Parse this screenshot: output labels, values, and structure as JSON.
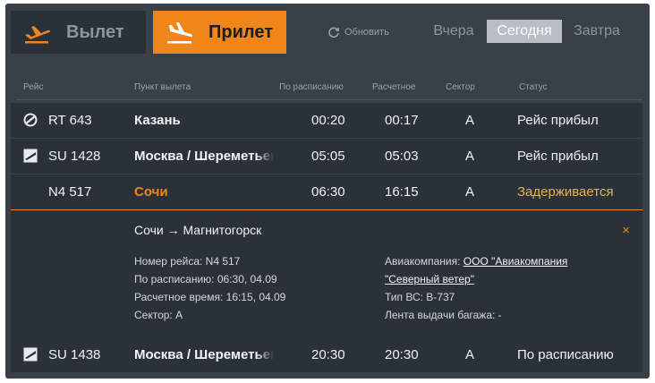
{
  "tabs": {
    "departure": {
      "label": "Вылет"
    },
    "arrival": {
      "label": "Прилет"
    }
  },
  "refresh": {
    "label": "Обновить"
  },
  "days": {
    "yesterday": "Вчера",
    "today": "Сегодня",
    "tomorrow": "Завтра"
  },
  "columns": {
    "flight": "Рейс",
    "origin": "Пункт вылета",
    "scheduled": "По расписанию",
    "estimated": "Расчетное",
    "sector": "Сектор",
    "status": "Статус"
  },
  "flights": [
    {
      "icon": "airline-circle-logo-icon",
      "flight": "RT 643",
      "city": "Казань",
      "scheduled": "00:20",
      "estimated": "00:17",
      "sector": "A",
      "status": "Рейс прибыл"
    },
    {
      "icon": "airline-wing-logo-icon",
      "flight": "SU 1428",
      "city": "Москва / Шереметьево",
      "scheduled": "05:05",
      "estimated": "05:03",
      "sector": "A",
      "status": "Рейс прибыл"
    },
    {
      "icon": "",
      "flight": "N4 517",
      "city": "Сочи",
      "scheduled": "06:30",
      "estimated": "16:15",
      "sector": "A",
      "status": "Задерживается"
    },
    {
      "icon": "airline-wing-logo-icon",
      "flight": "SU 1438",
      "city": "Москва / Шереметьево",
      "scheduled": "20:30",
      "estimated": "20:30",
      "sector": "A",
      "status": "По расписанию"
    }
  ],
  "detail": {
    "route": "Сочи → Магнитогорск",
    "flight_number": "Номер рейса: N4 517",
    "scheduled": "По расписанию: 06:30, 04.09",
    "estimated": "Расчетное время: 16:15, 04.09",
    "sector": "Сектор: A",
    "airline_label": "Авиакомпания:",
    "airline_line1": "ООО \"Авиакомпания",
    "airline_line2": "\"Северный ветер\"",
    "aircraft": "Тип ВС: B-737",
    "baggage": "Лента выдачи багажа: -",
    "close": "×"
  },
  "colors": {
    "accent": "#f08519",
    "board": "#3a4048",
    "row": "#2b3138",
    "delayed": "#e5b25a"
  }
}
